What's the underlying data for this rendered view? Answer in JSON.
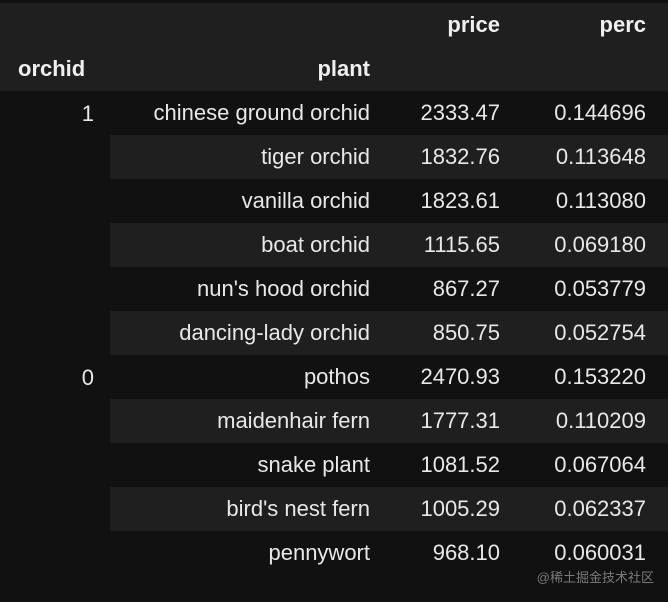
{
  "table": {
    "columns": [
      "price",
      "perc"
    ],
    "index_names": [
      "orchid",
      "plant"
    ],
    "groups": [
      {
        "orchid": "1",
        "rows": [
          {
            "plant": "chinese ground orchid",
            "price": "2333.47",
            "perc": "0.144696"
          },
          {
            "plant": "tiger orchid",
            "price": "1832.76",
            "perc": "0.113648"
          },
          {
            "plant": "vanilla orchid",
            "price": "1823.61",
            "perc": "0.113080"
          },
          {
            "plant": "boat orchid",
            "price": "1115.65",
            "perc": "0.069180"
          },
          {
            "plant": "nun's hood orchid",
            "price": "867.27",
            "perc": "0.053779"
          },
          {
            "plant": "dancing-lady orchid",
            "price": "850.75",
            "perc": "0.052754"
          }
        ]
      },
      {
        "orchid": "0",
        "rows": [
          {
            "plant": "pothos",
            "price": "2470.93",
            "perc": "0.153220"
          },
          {
            "plant": "maidenhair fern",
            "price": "1777.31",
            "perc": "0.110209"
          },
          {
            "plant": "snake plant",
            "price": "1081.52",
            "perc": "0.067064"
          },
          {
            "plant": "bird's nest fern",
            "price": "1005.29",
            "perc": "0.062337"
          },
          {
            "plant": "pennywort",
            "price": "968.10",
            "perc": "0.060031"
          }
        ]
      }
    ]
  },
  "watermark": "@稀土掘金技术社区",
  "colors": {
    "background": "#111111",
    "stripe": "#1f1f1f",
    "text": "#e8e8e8"
  }
}
